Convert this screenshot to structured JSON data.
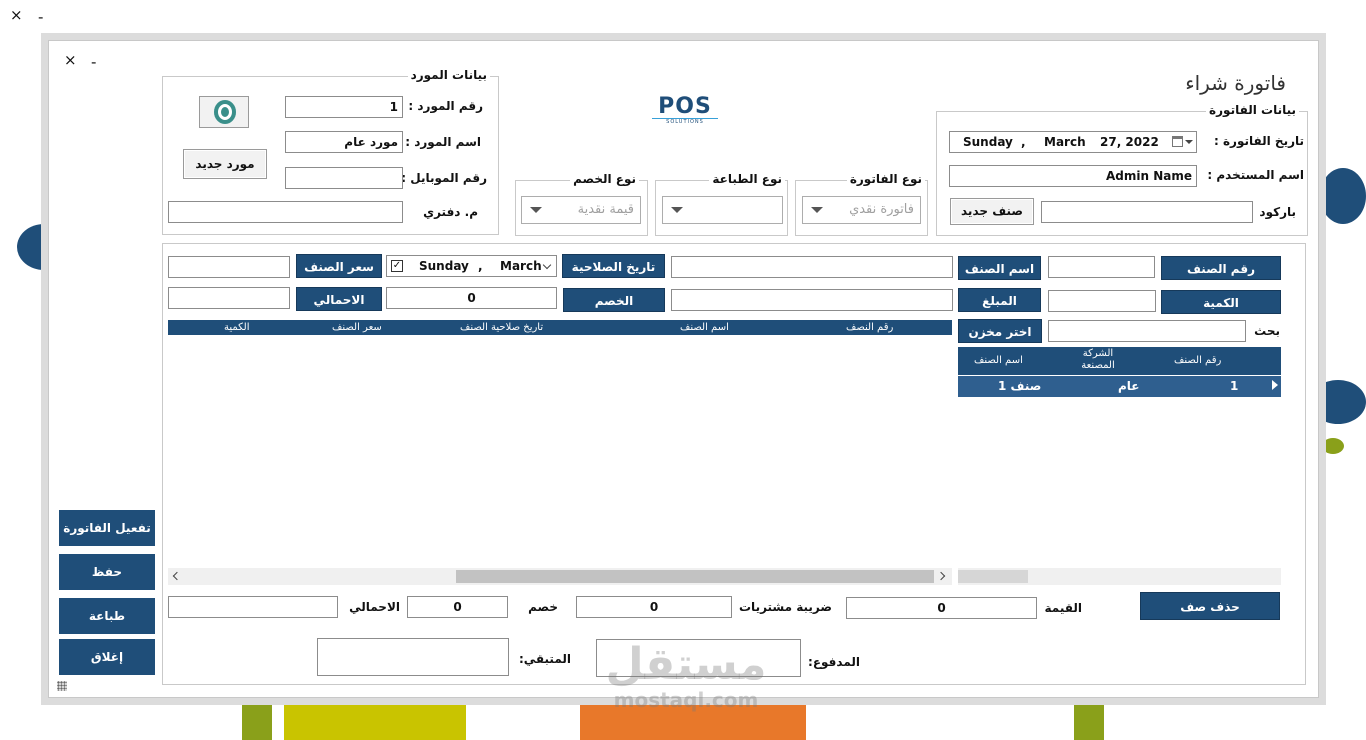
{
  "window": {
    "close_glyph": "×",
    "minimize_glyph": "-"
  },
  "dialog": {
    "close_glyph": "×",
    "minimize_glyph": "-",
    "title": "فاتورة شراء",
    "logo": {
      "text": "POS",
      "subtext": "SOLUTIONS"
    }
  },
  "invoice_group": {
    "title": "بيانات الفاتورة",
    "date_label": "تاريخ الفاتورة :",
    "date": {
      "day": "Sunday",
      "sep": ",",
      "month": "March",
      "daynum": "27, 2022"
    },
    "user_label": "اسم المستخدم :",
    "user_value": "Admin Name",
    "barcode_label": "باركود",
    "barcode_value": "",
    "new_item_button": "صنف جديد"
  },
  "supplier_group": {
    "title": "بيانات المورد",
    "id_label": "رقم المورد :",
    "id_value": "1",
    "name_label": "اسم المورد :",
    "name_value": "مورد عام",
    "mobile_label": "رقم الموبايل :",
    "mobile_value": "",
    "ledger_label": "م. دفتري",
    "ledger_value": "",
    "new_supplier_button": "مورد جديد"
  },
  "invoice_type": {
    "title": "نوع الفاتورة",
    "value": "فاتورة نقدي"
  },
  "print_type": {
    "title": "نوع الطباعة",
    "value": ""
  },
  "discount_type": {
    "title": "نوع الخصم",
    "value": "قيمة نقدية"
  },
  "item_entry": {
    "item_number_button": "رقم الصنف",
    "item_number_value": "",
    "item_name_button": "اسم الصنف",
    "item_name_value": "",
    "expiry_button": "تاريخ الصلاحية",
    "expiry_date": {
      "day": "Sunday",
      "sep": ",",
      "month": "March"
    },
    "price_button": "سعر الصنف",
    "price_value": "",
    "quantity_button": "الكمية",
    "quantity_value": "",
    "amount_button": "المبلغ",
    "amount_value": "",
    "discount_button": "الخصم",
    "discount_value": "0",
    "total_button": "الاحمالي",
    "total_value": "",
    "store_button": "اختر مخزن",
    "search_label": "بحث",
    "search_value": ""
  },
  "items_grid": {
    "columns": [
      "رقم النصف",
      "اسم الصنف",
      "تاريخ صلاحية الصنف",
      "سعر الصنف",
      "الكمية"
    ]
  },
  "search_grid": {
    "columns": [
      "رقم الصنف",
      "الشركة المصنعة",
      "اسم الصنف"
    ],
    "rows": [
      {
        "number": "1",
        "company": "عام",
        "name": "صنف 1"
      }
    ]
  },
  "totals": {
    "value_label": "القيمة",
    "value": "0",
    "tax_label": "ضريبة مشتريات",
    "tax": "0",
    "discount_label": "خصم",
    "discount": "0",
    "total_label": "الاحمالي",
    "total": "",
    "paid_label": "المدفوع:",
    "paid": "",
    "remaining_label": "المتبقي:",
    "remaining": "",
    "delete_button": "حذف صف"
  },
  "side_buttons": {
    "activate": "تفعيل الفاتورة",
    "save": "حفظ",
    "print": "طباعة",
    "close": "إغلاق"
  },
  "watermark": {
    "arabic": "مستقل",
    "latin": "mostaql.com"
  }
}
